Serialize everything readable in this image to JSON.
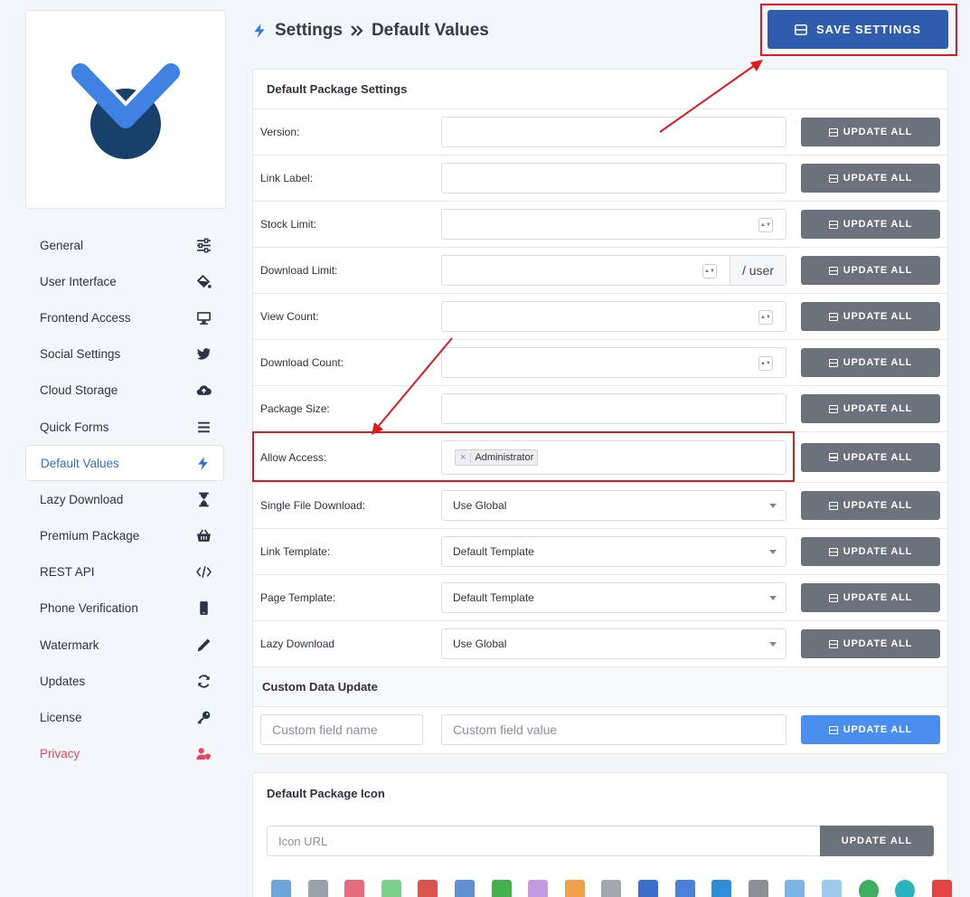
{
  "header": {
    "breadcrumb_root": "Settings",
    "breadcrumb_current": "Default Values",
    "save_label": "SAVE SETTINGS"
  },
  "sidebar": {
    "items": [
      {
        "label": "General",
        "icon": "sliders-icon"
      },
      {
        "label": "User Interface",
        "icon": "paint-bucket-icon"
      },
      {
        "label": "Frontend Access",
        "icon": "desktop-icon"
      },
      {
        "label": "Social Settings",
        "icon": "twitter-icon"
      },
      {
        "label": "Cloud Storage",
        "icon": "cloud-upload-icon"
      },
      {
        "label": "Quick Forms",
        "icon": "bars-icon"
      },
      {
        "label": "Default Values",
        "icon": "bolt-icon"
      },
      {
        "label": "Lazy Download",
        "icon": "hourglass-icon"
      },
      {
        "label": "Premium Package",
        "icon": "basket-icon"
      },
      {
        "label": "REST API",
        "icon": "code-icon"
      },
      {
        "label": "Phone Verification",
        "icon": "mobile-icon"
      },
      {
        "label": "Watermark",
        "icon": "pen-icon"
      },
      {
        "label": "Updates",
        "icon": "sync-icon"
      },
      {
        "label": "License",
        "icon": "key-icon"
      },
      {
        "label": "Privacy",
        "icon": "user-shield-icon"
      }
    ]
  },
  "package_settings": {
    "title": "Default Package Settings",
    "update_label": "UPDATE ALL",
    "rows": [
      {
        "label": "Version:"
      },
      {
        "label": "Link Label:"
      },
      {
        "label": "Stock Limit:"
      },
      {
        "label": "Download Limit:",
        "addon": "/ user"
      },
      {
        "label": "View Count:"
      },
      {
        "label": "Download Count:"
      },
      {
        "label": "Package Size:"
      },
      {
        "label": "Allow Access:",
        "tag": "Administrator"
      },
      {
        "label": "Single File Download:",
        "value": "Use Global"
      },
      {
        "label": "Link Template:",
        "value": "Default Template"
      },
      {
        "label": "Page Template:",
        "value": "Default Template"
      },
      {
        "label": "Lazy Download",
        "value": "Use Global"
      }
    ]
  },
  "custom_data": {
    "title": "Custom Data Update",
    "name_placeholder": "Custom field name",
    "value_placeholder": "Custom field value",
    "update_label": "UPDATE ALL"
  },
  "package_icon": {
    "title": "Default Package Icon",
    "url_placeholder": "Icon URL",
    "update_label": "UPDATE ALL"
  },
  "colors": {
    "accent": "#2f5cad",
    "active": "#2f6fd8",
    "update_btn": "#6c727b",
    "update_btn_blue": "#4a8ef0",
    "highlight": "#e0191c",
    "privacy": "#e5485c"
  }
}
